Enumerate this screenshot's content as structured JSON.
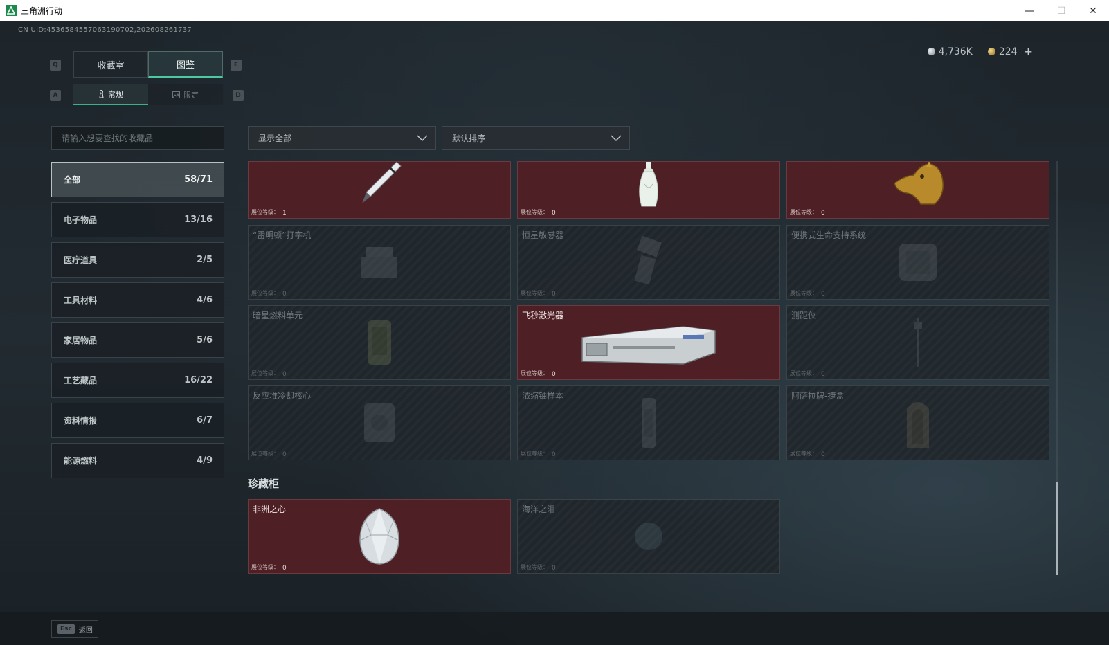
{
  "window": {
    "title": "三角洲行动",
    "controls": [
      "minimize",
      "maximize",
      "close"
    ]
  },
  "uid": "CN UID:4536584557063190702,202608261737",
  "currency": {
    "silver": "4,736K",
    "gold": "224",
    "add_label": "+"
  },
  "key_hints": {
    "prev_tab": "Q",
    "next_tab": "E",
    "prev_sub": "A",
    "next_sub": "D"
  },
  "tabs": [
    {
      "label": "收藏室",
      "active": false
    },
    {
      "label": "图鉴",
      "active": true
    }
  ],
  "sub_tabs": [
    {
      "label": "常规",
      "icon": "pawn-icon",
      "active": true
    },
    {
      "label": "限定",
      "icon": "picture-icon",
      "active": false
    }
  ],
  "search": {
    "placeholder": "请输入想要查找的收藏品",
    "value": ""
  },
  "filters": {
    "show": "显示全部",
    "sort": "默认排序"
  },
  "categories": [
    {
      "label": "全部",
      "count": "58/71",
      "active": true
    },
    {
      "label": "电子物品",
      "count": "13/16",
      "active": false
    },
    {
      "label": "医疗道具",
      "count": "2/5",
      "active": false
    },
    {
      "label": "工具材料",
      "count": "4/6",
      "active": false
    },
    {
      "label": "家居物品",
      "count": "5/6",
      "active": false
    },
    {
      "label": "工艺藏品",
      "count": "16/22",
      "active": false
    },
    {
      "label": "资料情报",
      "count": "6/7",
      "active": false
    },
    {
      "label": "能源燃料",
      "count": "4/9",
      "active": false
    }
  ],
  "level_label": "展位等级：",
  "items": [
    {
      "name": "",
      "level": "1",
      "owned": true,
      "icon": "fountain-pen-icon"
    },
    {
      "name": "",
      "level": "0",
      "owned": true,
      "icon": "porcelain-vase-icon"
    },
    {
      "name": "",
      "level": "0",
      "owned": true,
      "icon": "golden-beast-head-icon"
    },
    {
      "name": "“雷明顿”打字机",
      "level": "0",
      "owned": false,
      "icon": "typewriter-icon"
    },
    {
      "name": "恒星敏感器",
      "level": "0",
      "owned": false,
      "icon": "star-sensor-icon"
    },
    {
      "name": "便携式生命支持系统",
      "level": "0",
      "owned": false,
      "icon": "life-support-icon"
    },
    {
      "name": "暗星燃料单元",
      "level": "0",
      "owned": false,
      "icon": "fuel-cell-icon"
    },
    {
      "name": "飞秒激光器",
      "level": "0",
      "owned": true,
      "icon": "laser-case-icon"
    },
    {
      "name": "测距仪",
      "level": "0",
      "owned": false,
      "icon": "rangefinder-icon"
    },
    {
      "name": "反应堆冷却核心",
      "level": "0",
      "owned": false,
      "icon": "reactor-core-icon"
    },
    {
      "name": "浓缩铀样本",
      "level": "0",
      "owned": false,
      "icon": "uranium-sample-icon"
    },
    {
      "name": "阿萨拉牌-捷盒",
      "level": "0",
      "owned": false,
      "icon": "card-box-icon"
    }
  ],
  "vault": {
    "title": "珍藏柜",
    "items": [
      {
        "name": "非洲之心",
        "level": "0",
        "owned": true,
        "icon": "diamond-icon"
      },
      {
        "name": "海洋之泪",
        "level": "0",
        "owned": false,
        "icon": "sea-gem-icon"
      }
    ]
  },
  "footer": {
    "key": "Esc",
    "label": "返回"
  },
  "colors": {
    "owned_card": "#4e1f24",
    "accent": "#4cc9a0",
    "background": "#1d252b"
  }
}
